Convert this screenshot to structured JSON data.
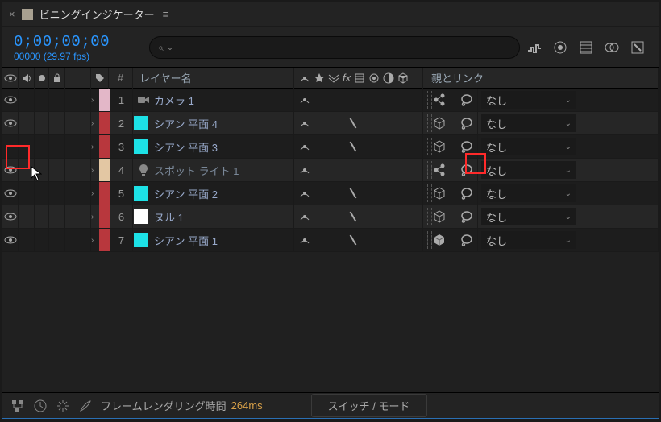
{
  "panel": {
    "title": "ビニングインジケーター"
  },
  "timecode": "0;00;00;00",
  "frame_fps": "00000 (29.97 fps)",
  "columns": {
    "num": "#",
    "layer_name": "レイヤー名",
    "parent": "親とリンク"
  },
  "layers": [
    {
      "num": "1",
      "name": "カメラ 1",
      "color": "#e3b7c8",
      "type": "camera",
      "eye": true,
      "shy": true,
      "slash": false,
      "cube": "share",
      "parent": "なし"
    },
    {
      "num": "2",
      "name": "シアン 平面 4",
      "color": "#b8373d",
      "type": "solid",
      "sq": "#1de1e6",
      "eye": true,
      "shy": true,
      "slash": true,
      "cube": "cube",
      "parent": "なし"
    },
    {
      "num": "3",
      "name": "シアン 平面 3",
      "color": "#b8373d",
      "type": "solid",
      "sq": "#1de1e6",
      "eye": false,
      "shy": true,
      "slash": true,
      "cube": "cube",
      "parent": "なし"
    },
    {
      "num": "4",
      "name": "スポット ライト 1",
      "color": "#e3c7a3",
      "type": "light",
      "eye": true,
      "shy": true,
      "slash": false,
      "cube": "share",
      "parent": "なし",
      "dim": true
    },
    {
      "num": "5",
      "name": "シアン 平面 2",
      "color": "#b8373d",
      "type": "solid",
      "sq": "#1de1e6",
      "eye": true,
      "shy": true,
      "slash": true,
      "cube": "cube",
      "parent": "なし"
    },
    {
      "num": "6",
      "name": "ヌル 1",
      "color": "#b8373d",
      "type": "solid",
      "sq": "#ffffff",
      "eye": true,
      "shy": true,
      "slash": true,
      "cube": "cube",
      "parent": "なし"
    },
    {
      "num": "7",
      "name": "シアン 平面 1",
      "color": "#b8373d",
      "type": "solid",
      "sq": "#1de1e6",
      "eye": true,
      "shy": true,
      "slash": true,
      "cube": "cube-fill",
      "parent": "なし"
    }
  ],
  "footer": {
    "render_label": "フレームレンダリング時間",
    "render_time": "264ms",
    "mode": "スイッチ / モード"
  }
}
